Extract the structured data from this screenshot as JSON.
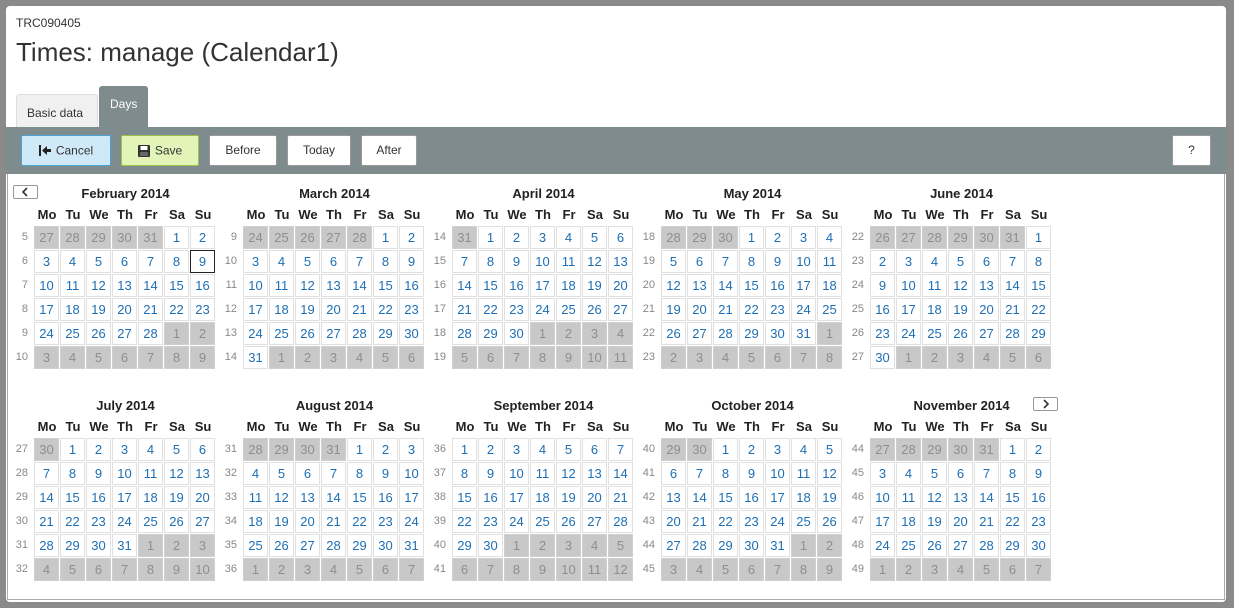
{
  "header": {
    "code": "TRC090405",
    "title": "Times: manage (Calendar1)"
  },
  "tabs": [
    {
      "label": "Basic data",
      "active": false
    },
    {
      "label": "Days",
      "active": true
    }
  ],
  "toolbar": {
    "cancel": "Cancel",
    "save": "Save",
    "before": "Before",
    "today": "Today",
    "after": "After",
    "help": "?"
  },
  "calendar": {
    "weekday_labels": [
      "Mo",
      "Tu",
      "We",
      "Th",
      "Fr",
      "Sa",
      "Su"
    ],
    "today": "2014-02-09",
    "months": [
      {
        "name": "February 2014",
        "year": 2014,
        "month": 2
      },
      {
        "name": "March 2014",
        "year": 2014,
        "month": 3
      },
      {
        "name": "April 2014",
        "year": 2014,
        "month": 4
      },
      {
        "name": "May 2014",
        "year": 2014,
        "month": 5
      },
      {
        "name": "June 2014",
        "year": 2014,
        "month": 6
      },
      {
        "name": "July 2014",
        "year": 2014,
        "month": 7
      },
      {
        "name": "August 2014",
        "year": 2014,
        "month": 8
      },
      {
        "name": "September 2014",
        "year": 2014,
        "month": 9
      },
      {
        "name": "October 2014",
        "year": 2014,
        "month": 10
      },
      {
        "name": "November 2014",
        "year": 2014,
        "month": 11
      }
    ]
  },
  "icons": {
    "cancel": "exit-arrow-icon",
    "save": "floppy-disk-icon",
    "prev": "chevron-left-icon",
    "next": "chevron-right-icon"
  },
  "colors": {
    "toolbar": "#7f8c8d",
    "day_link": "#1e6fb4",
    "other_month": "#c8c8c8"
  }
}
